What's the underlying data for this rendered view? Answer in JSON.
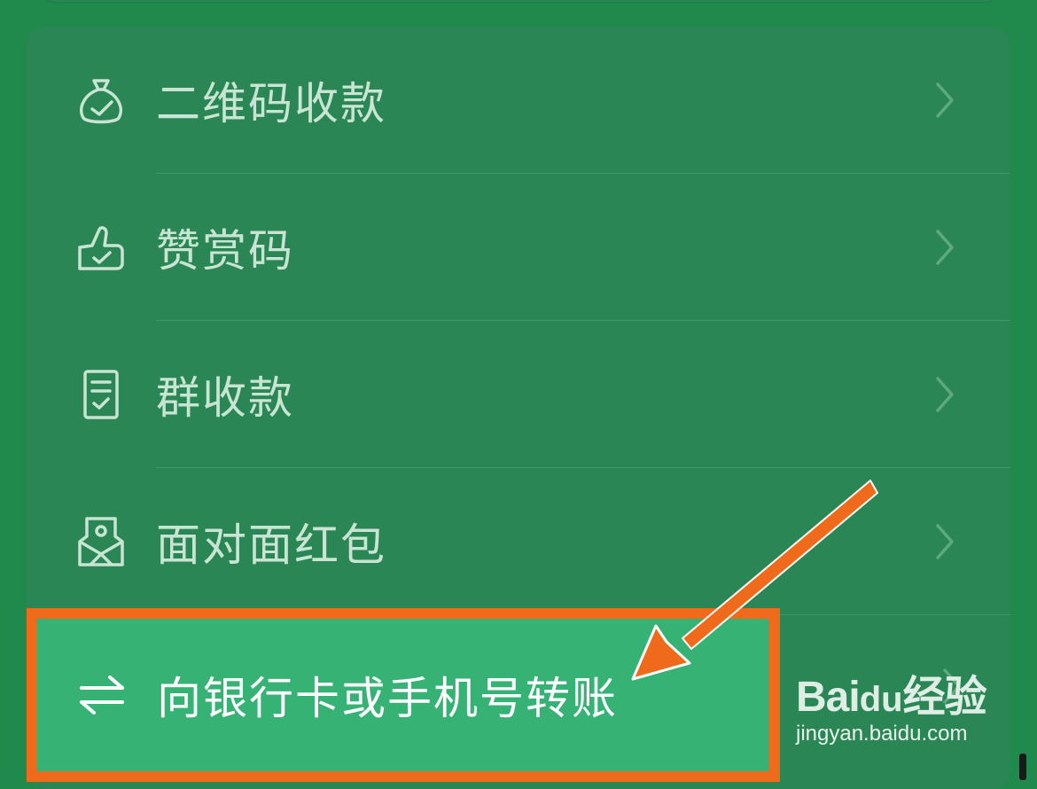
{
  "menu": {
    "items": [
      {
        "label": "二维码收款",
        "icon": "money-bag-icon"
      },
      {
        "label": "赞赏码",
        "icon": "thumbs-up-icon"
      },
      {
        "label": "群收款",
        "icon": "receipt-icon"
      },
      {
        "label": "面对面红包",
        "icon": "red-packet-icon"
      }
    ],
    "highlighted": {
      "label": "向银行卡或手机号转账",
      "icon": "transfer-arrows-icon"
    }
  },
  "watermark": {
    "logo_text_1": "Bai",
    "logo_text_2": "du",
    "logo_text_3": "经验",
    "sub_text": "jingyan.baidu.com"
  },
  "colors": {
    "background": "#1f8a4c",
    "card": "#2b8656",
    "highlight_fill": "#36b374",
    "annotation": "#f06a1c",
    "label_text": "#c8e4d2"
  }
}
